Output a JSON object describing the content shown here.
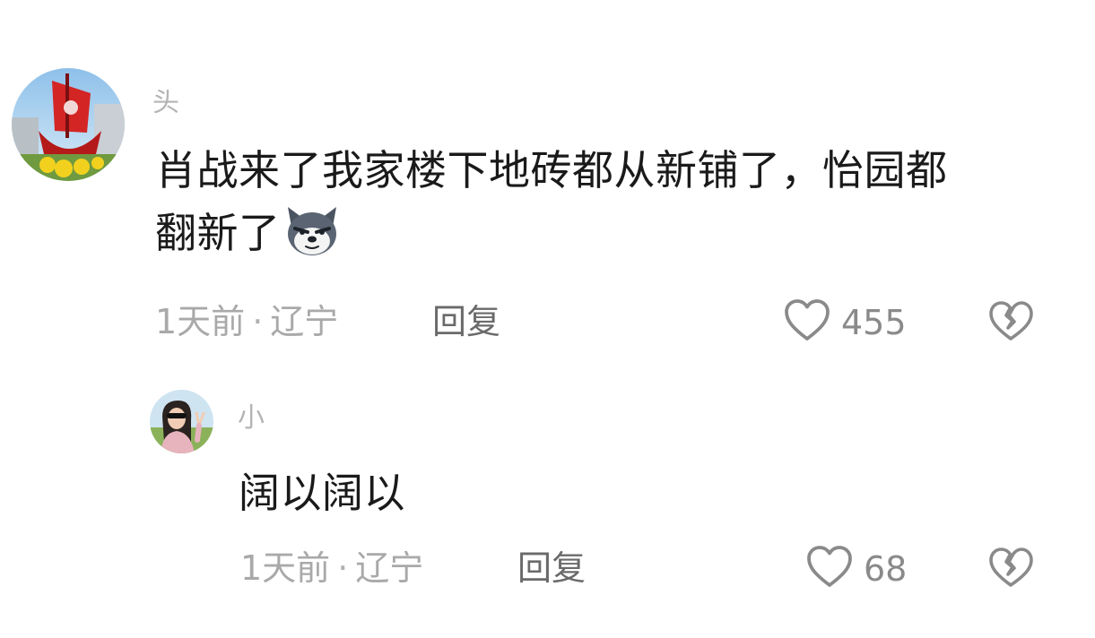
{
  "comments": [
    {
      "username": "头",
      "text_line1": "肖战来了我家楼下地砖都从新铺了，怡园都",
      "text_line2": "翻新了",
      "emoji": "smug-dog-emoji",
      "time": "1天前",
      "separator": "·",
      "location": "辽宁",
      "reply_label": "回复",
      "likes": "455"
    },
    {
      "username": "小",
      "text": "阔以阔以",
      "time": "1天前",
      "separator": "·",
      "location": "辽宁",
      "reply_label": "回复",
      "likes": "68"
    }
  ],
  "icons": {
    "like": "heart-outline-icon",
    "dislike": "broken-heart-icon"
  },
  "colors": {
    "text": "#1a1a1a",
    "meta": "#a9a9a9",
    "reply": "#6a6a6a",
    "icon": "#8a8a8a"
  }
}
